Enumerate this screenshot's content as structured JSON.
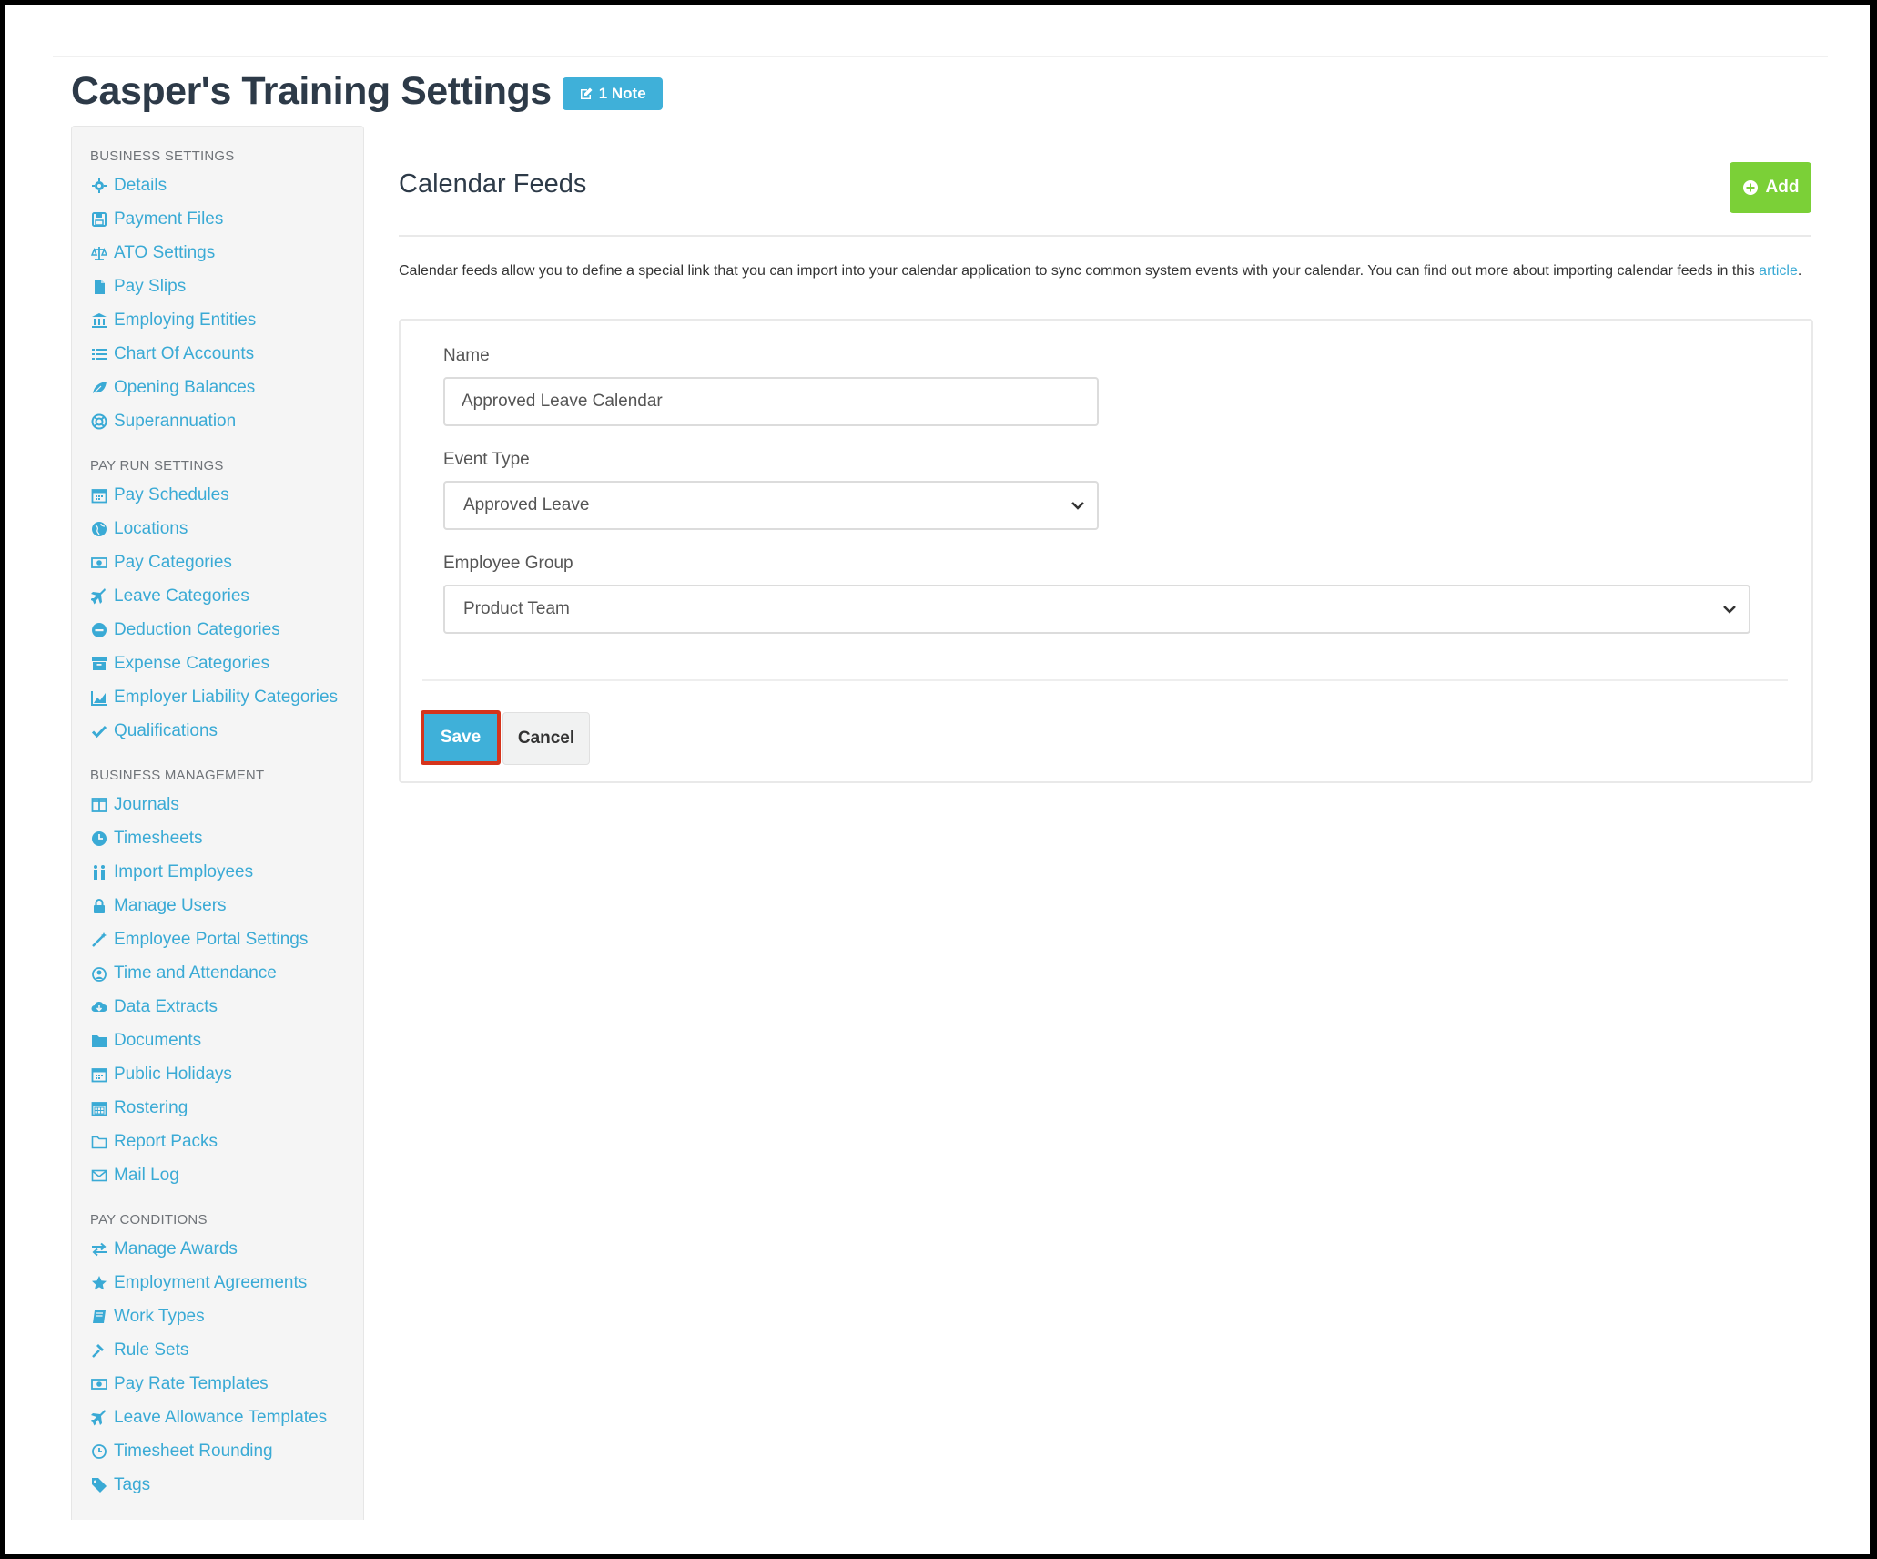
{
  "page": {
    "title": "Casper's Training Settings",
    "note_badge": "1 Note"
  },
  "sidebar": {
    "sections": [
      {
        "heading": "BUSINESS SETTINGS",
        "items": [
          {
            "label": "Details",
            "icon": "gear-icon"
          },
          {
            "label": "Payment Files",
            "icon": "floppy-icon"
          },
          {
            "label": "ATO Settings",
            "icon": "scale-icon"
          },
          {
            "label": "Pay Slips",
            "icon": "file-icon"
          },
          {
            "label": "Employing Entities",
            "icon": "bank-icon"
          },
          {
            "label": "Chart Of Accounts",
            "icon": "list-icon"
          },
          {
            "label": "Opening Balances",
            "icon": "leaf-icon"
          },
          {
            "label": "Superannuation",
            "icon": "life-ring-icon"
          }
        ]
      },
      {
        "heading": "PAY RUN SETTINGS",
        "items": [
          {
            "label": "Pay Schedules",
            "icon": "calendar-icon"
          },
          {
            "label": "Locations",
            "icon": "globe-icon"
          },
          {
            "label": "Pay Categories",
            "icon": "money-icon"
          },
          {
            "label": "Leave Categories",
            "icon": "plane-icon"
          },
          {
            "label": "Deduction Categories",
            "icon": "minus-circle-icon"
          },
          {
            "label": "Expense Categories",
            "icon": "archive-icon"
          },
          {
            "label": "Employer Liability Categories",
            "icon": "chart-icon"
          },
          {
            "label": "Qualifications",
            "icon": "check-icon"
          }
        ]
      },
      {
        "heading": "BUSINESS MANAGEMENT",
        "items": [
          {
            "label": "Journals",
            "icon": "columns-icon"
          },
          {
            "label": "Timesheets",
            "icon": "clock-icon"
          },
          {
            "label": "Import Employees",
            "icon": "people-icon"
          },
          {
            "label": "Manage Users",
            "icon": "lock-icon"
          },
          {
            "label": "Employee Portal Settings",
            "icon": "wand-icon"
          },
          {
            "label": "Time and Attendance",
            "icon": "user-clock-icon"
          },
          {
            "label": "Data Extracts",
            "icon": "cloud-download-icon"
          },
          {
            "label": "Documents",
            "icon": "folder-icon"
          },
          {
            "label": "Public Holidays",
            "icon": "calendar-icon"
          },
          {
            "label": "Rostering",
            "icon": "calendar-grid-icon"
          },
          {
            "label": "Report Packs",
            "icon": "folder-outline-icon"
          },
          {
            "label": "Mail Log",
            "icon": "envelope-icon"
          }
        ]
      },
      {
        "heading": "PAY CONDITIONS",
        "items": [
          {
            "label": "Manage Awards",
            "icon": "exchange-icon"
          },
          {
            "label": "Employment Agreements",
            "icon": "star-icon"
          },
          {
            "label": "Work Types",
            "icon": "book-icon"
          },
          {
            "label": "Rule Sets",
            "icon": "gavel-icon"
          },
          {
            "label": "Pay Rate Templates",
            "icon": "money-icon"
          },
          {
            "label": "Leave Allowance Templates",
            "icon": "plane-icon"
          },
          {
            "label": "Timesheet Rounding",
            "icon": "clock-outline-icon"
          },
          {
            "label": "Tags",
            "icon": "tag-icon"
          }
        ]
      }
    ]
  },
  "main": {
    "title": "Calendar Feeds",
    "add_label": "Add",
    "description_prefix": "Calendar feeds allow you to define a special link that you can import into your calendar application to sync common system events with your calendar. You can find out more about importing calendar feeds in this ",
    "description_link": "article",
    "description_suffix": ".",
    "form": {
      "name_label": "Name",
      "name_value": "Approved Leave Calendar",
      "event_type_label": "Event Type",
      "event_type_value": "Approved Leave",
      "employee_group_label": "Employee Group",
      "employee_group_value": "Product Team",
      "save_label": "Save",
      "cancel_label": "Cancel"
    }
  },
  "colors": {
    "link": "#3aaad5",
    "primary": "#3fb0d9",
    "success": "#7bd037",
    "highlight_border": "#d5341c",
    "heading": "#2d3a48"
  }
}
